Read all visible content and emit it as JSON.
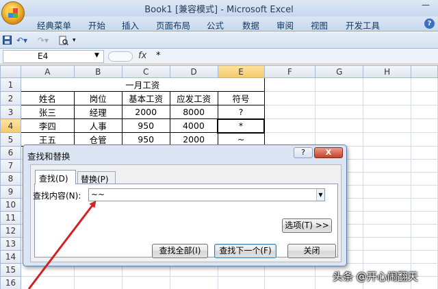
{
  "window": {
    "title": "Book1  [兼容模式] - Microsoft Excel",
    "minimize_glyph": "—"
  },
  "ribbon_tabs": [
    "经典菜单",
    "开始",
    "插入",
    "页面布局",
    "公式",
    "数据",
    "审阅",
    "视图",
    "开发工具"
  ],
  "quick_access": {
    "save_icon": "floppy-icon",
    "undo_icon": "undo-icon",
    "redo_icon": "redo-icon",
    "print_preview_icon": "print-preview-icon"
  },
  "formula_bar": {
    "name_box": "E4",
    "fx_label": "fx",
    "content": "*"
  },
  "sheet": {
    "columns": [
      "A",
      "B",
      "C",
      "D",
      "E",
      "F",
      "G",
      "H"
    ],
    "rows": [
      "1",
      "2",
      "3",
      "4",
      "5",
      "6",
      "7",
      "8",
      "9",
      "10",
      "11",
      "12",
      "13",
      "14",
      "15",
      "16",
      "17"
    ],
    "selected_cell": "E4",
    "title_cell": "一月工资",
    "headers": [
      "姓名",
      "岗位",
      "基本工资",
      "应发工资",
      "符号"
    ],
    "data": [
      [
        "张三",
        "经理",
        "2000",
        "8000",
        "?"
      ],
      [
        "李四",
        "人事",
        "950",
        "4000",
        "*"
      ],
      [
        "王五",
        "仓管",
        "950",
        "2000",
        "~"
      ]
    ]
  },
  "dialog": {
    "title": "查找和替换",
    "help_label": "?",
    "close_label": "X",
    "tab_find": "查找(D)",
    "tab_replace": "替换(P)",
    "find_label": "查找内容(N):",
    "find_value": "~~",
    "options_button": "选项(T) >>",
    "find_all_button": "查找全部(I)",
    "find_next_button": "查找下一个(F)",
    "close_button": "关闭"
  },
  "watermark": "头条 @开心闹翻天",
  "colors": {
    "selection_highlight": "#f5c96a",
    "annotation_arrow": "#d42020"
  }
}
